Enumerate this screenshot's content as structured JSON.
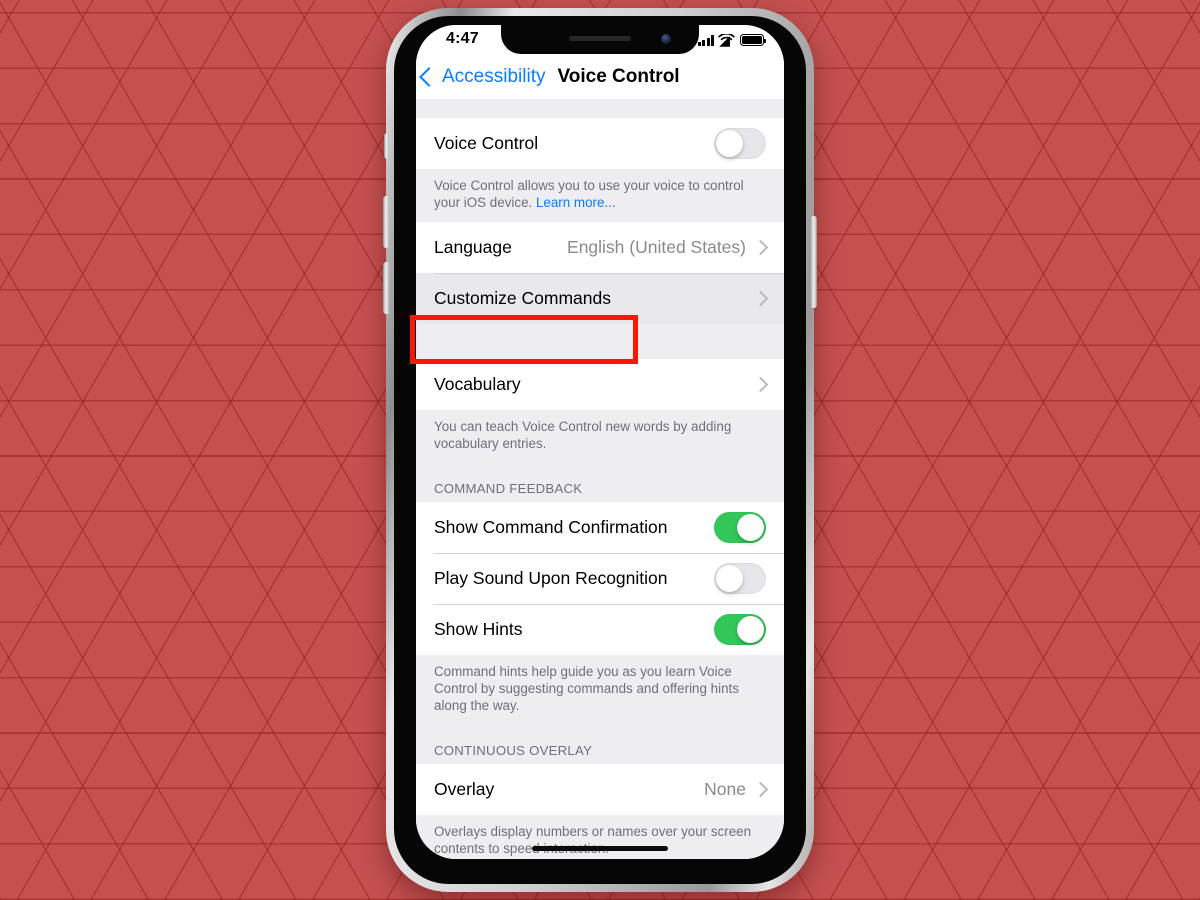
{
  "background": {
    "color": "#c45050",
    "pattern": "triangular-lattice"
  },
  "device": {
    "frame": "iphone-x",
    "notch": true
  },
  "status_bar": {
    "time": "4:47",
    "icons": [
      "cellular-signal-icon",
      "wifi-icon",
      "battery-icon"
    ]
  },
  "nav": {
    "back_label": "Accessibility",
    "title": "Voice Control",
    "back_icon": "chevron-left-icon"
  },
  "sections": [
    {
      "name": "voice-control",
      "rows": [
        {
          "label": "Voice Control",
          "type": "toggle",
          "on": false
        }
      ],
      "footnote": "Voice Control allows you to use your voice to control your iOS device. ",
      "footnote_link": "Learn more..."
    },
    {
      "name": "language-commands",
      "rows": [
        {
          "label": "Language",
          "type": "disclosure",
          "value": "English (United States)"
        },
        {
          "label": "Customize Commands",
          "type": "disclosure",
          "value": "",
          "pressed": true
        }
      ]
    },
    {
      "name": "vocabulary",
      "rows": [
        {
          "label": "Vocabulary",
          "type": "disclosure",
          "value": ""
        }
      ],
      "footnote": "You can teach Voice Control new words by adding vocabulary entries."
    },
    {
      "name": "command-feedback",
      "header": "COMMAND FEEDBACK",
      "rows": [
        {
          "label": "Show Command Confirmation",
          "type": "toggle",
          "on": true
        },
        {
          "label": "Play Sound Upon Recognition",
          "type": "toggle",
          "on": false
        },
        {
          "label": "Show Hints",
          "type": "toggle",
          "on": true
        }
      ],
      "footnote": "Command hints help guide you as you learn Voice Control by suggesting commands and offering hints along the way."
    },
    {
      "name": "continuous-overlay",
      "header": "CONTINUOUS OVERLAY",
      "rows": [
        {
          "label": "Overlay",
          "type": "disclosure",
          "value": "None"
        }
      ],
      "footnote": "Overlays display numbers or names over your screen contents to speed interaction."
    }
  ],
  "annotation": {
    "color": "#fa1802",
    "target": "Customize Commands"
  },
  "colors": {
    "accent_blue": "#0a7cff",
    "toggle_on_green": "#33c759",
    "group_background": "#eeedf2",
    "secondary_text": "#8a8a8e"
  }
}
